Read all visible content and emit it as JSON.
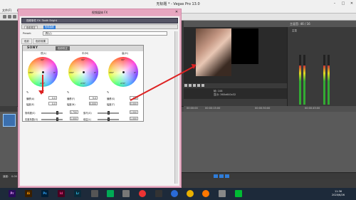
{
  "app": {
    "title": "无标题 * - Vegas Pro 13.0",
    "menu": [
      "文件(F)",
      "编辑(E)",
      "视图(V)",
      "插入(I)",
      "工具(T)",
      "选项(O)",
      "帮助(H)"
    ]
  },
  "preview": {
    "info_frame": "帧: 108",
    "info_res": "显示: 360x640x32",
    "ruler_ticks": [
      "00:00:00",
      "00:00:15:00",
      "00:00:30:00",
      "00:00:45:00"
    ]
  },
  "mixer": {
    "title": "主混音: 46 / 16",
    "label": "主控"
  },
  "plugin": {
    "window_title": "视频媒体 FX",
    "chain_label": "视频事件 FX:  Tooth Bright",
    "chain_chips": [
      "色彩校正",
      "色彩曲线"
    ],
    "preset_label": "Preset:",
    "preset_value": "(默认)",
    "tabs": [
      "色彩",
      "色彩效果"
    ],
    "brand": "SONY",
    "plugin_name": "色彩校正",
    "wheels": [
      {
        "label": "低(L)",
        "offset_label": "偏移(A)",
        "offset_value": "0.0",
        "mag_label": "幅度(E)",
        "mag_value": "0.0"
      },
      {
        "label": "中(M)",
        "offset_label": "偏移(F)",
        "offset_value": "9.0",
        "mag_label": "幅度(N)",
        "mag_value": "0.000"
      },
      {
        "label": "高(H)",
        "offset_label": "偏移(S)",
        "offset_value": "0.0",
        "mag_label": "幅度(T)",
        "mag_value": "0.000"
      }
    ],
    "degrees": [
      "90°",
      "180°",
      "0°",
      "270°"
    ],
    "bottom": [
      {
        "label": "饱和度(S)",
        "value": "1.700"
      },
      {
        "label": "伽马(G)",
        "value": "1.000"
      },
      {
        "label": "灰度系数(G)",
        "value": "1.000"
      },
      {
        "label": "增益(L)",
        "value": "1.000"
      }
    ]
  },
  "timeline": {
    "track_label": "速度:",
    "track_value": "0.00"
  },
  "taskbar": {
    "apps": [
      {
        "name": "Pr",
        "color": "#2a0a5a"
      },
      {
        "name": "Ai",
        "color": "#3a1f00"
      },
      {
        "name": "Ps",
        "color": "#001e36"
      },
      {
        "name": "Id",
        "color": "#4a0020"
      },
      {
        "name": "Lr",
        "color": "#0a2a3a"
      }
    ],
    "time": "11:36",
    "date": "2020/6/26"
  },
  "colors": {
    "accent": "#2f7cd8",
    "plugin_frame": "#e8b4c8",
    "arrow": "#d22"
  }
}
